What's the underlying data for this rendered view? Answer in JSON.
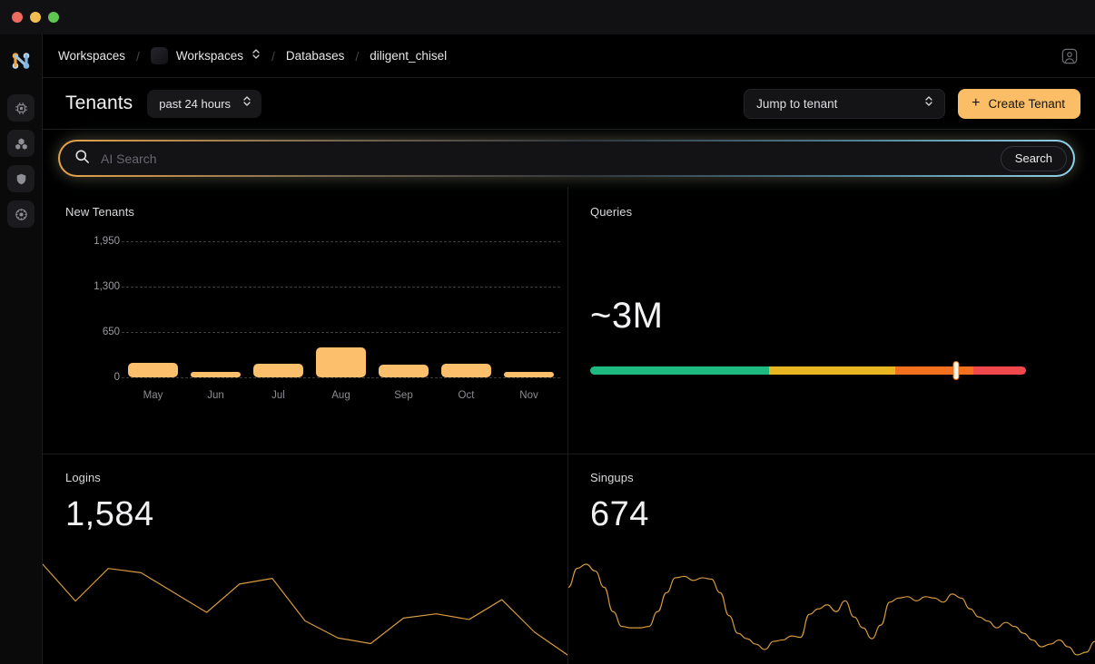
{
  "window": {
    "traffic_lights": [
      "close",
      "minimize",
      "zoom"
    ]
  },
  "brand": {
    "logo_name": "neon-logo"
  },
  "rail": {
    "items": [
      {
        "name": "chip-icon",
        "label": "Compute"
      },
      {
        "name": "nodes-icon",
        "label": "Branches"
      },
      {
        "name": "shield-icon",
        "label": "Security"
      },
      {
        "name": "gear-icon",
        "label": "Settings"
      }
    ]
  },
  "breadcrumb": {
    "item1": "Workspaces",
    "item2": "Workspaces",
    "item3": "Databases",
    "item4": "diligent_chisel",
    "separator": "/"
  },
  "header": {
    "title": "Tenants",
    "range_label": "past 24 hours",
    "tenant_select_label": "Jump to tenant",
    "create_label": "Create Tenant",
    "plus": "+"
  },
  "search": {
    "placeholder": "AI Search",
    "value": "",
    "button_label": "Search"
  },
  "panels": {
    "new_tenants_title": "New Tenants",
    "queries_title": "Queries",
    "logins_title": "Logins",
    "singups_title": "Singups"
  },
  "queries": {
    "value": "~3M",
    "gauge_marker_percent": 84,
    "segments": [
      {
        "label": "good",
        "color": "#1eb980",
        "percent": 41
      },
      {
        "label": "warn",
        "color": "#e8b621",
        "percent": 29
      },
      {
        "label": "high",
        "color": "#f3711e",
        "percent": 18
      },
      {
        "label": "critical",
        "color": "#f0484c",
        "percent": 12
      }
    ]
  },
  "logins": {
    "value": "1,584"
  },
  "singups": {
    "value": "674"
  },
  "chart_data": [
    {
      "type": "bar",
      "title": "New Tenants",
      "xlabel": "",
      "ylabel": "",
      "categories": [
        "May",
        "Jun",
        "Jul",
        "Aug",
        "Sep",
        "Oct",
        "Nov"
      ],
      "values": [
        208,
        62,
        195,
        430,
        182,
        200,
        52
      ],
      "yticks": [
        0,
        650,
        1300,
        1950
      ],
      "ylim": [
        0,
        1950
      ],
      "grid": true,
      "legend": "none",
      "color": "#fcc06d"
    },
    {
      "type": "line",
      "title": "Logins",
      "xlabel": "",
      "ylabel": "",
      "grid": false,
      "legend": "none",
      "color": "#d69a40",
      "ylim": [
        0,
        100
      ],
      "x": [
        0,
        1,
        2,
        3,
        4,
        5,
        6,
        7,
        8,
        9,
        10,
        11,
        12,
        13,
        14,
        15,
        16
      ],
      "values": [
        82,
        56,
        79,
        76,
        62,
        48,
        68,
        72,
        42,
        30,
        26,
        44,
        47,
        43,
        57,
        34,
        18
      ]
    },
    {
      "type": "line",
      "title": "Singups",
      "xlabel": "",
      "ylabel": "",
      "grid": false,
      "legend": "none",
      "color": "#d69a40",
      "ylim": [
        0,
        100
      ],
      "x": [
        0,
        1,
        2,
        3,
        4,
        5,
        6,
        7,
        8,
        9,
        10,
        11,
        12,
        13,
        14,
        15,
        16,
        17,
        18,
        19,
        20,
        21,
        22,
        23,
        24,
        25,
        26,
        27,
        28,
        29,
        30,
        31,
        32,
        33,
        34,
        35,
        36,
        37,
        38,
        39,
        40,
        41,
        42,
        43,
        44,
        45,
        46,
        47,
        48,
        49,
        50,
        51,
        52,
        53,
        54,
        55,
        56,
        57,
        58,
        59
      ],
      "values": [
        66,
        80,
        83,
        78,
        66,
        48,
        37,
        36,
        36,
        37,
        48,
        62,
        73,
        74,
        71,
        73,
        72,
        62,
        45,
        32,
        28,
        24,
        20,
        26,
        27,
        30,
        29,
        46,
        50,
        53,
        48,
        56,
        44,
        36,
        28,
        38,
        55,
        58,
        59,
        56,
        59,
        58,
        55,
        61,
        58,
        50,
        44,
        41,
        36,
        40,
        37,
        32,
        27,
        22,
        24,
        27,
        22,
        16,
        18,
        26
      ]
    }
  ]
}
